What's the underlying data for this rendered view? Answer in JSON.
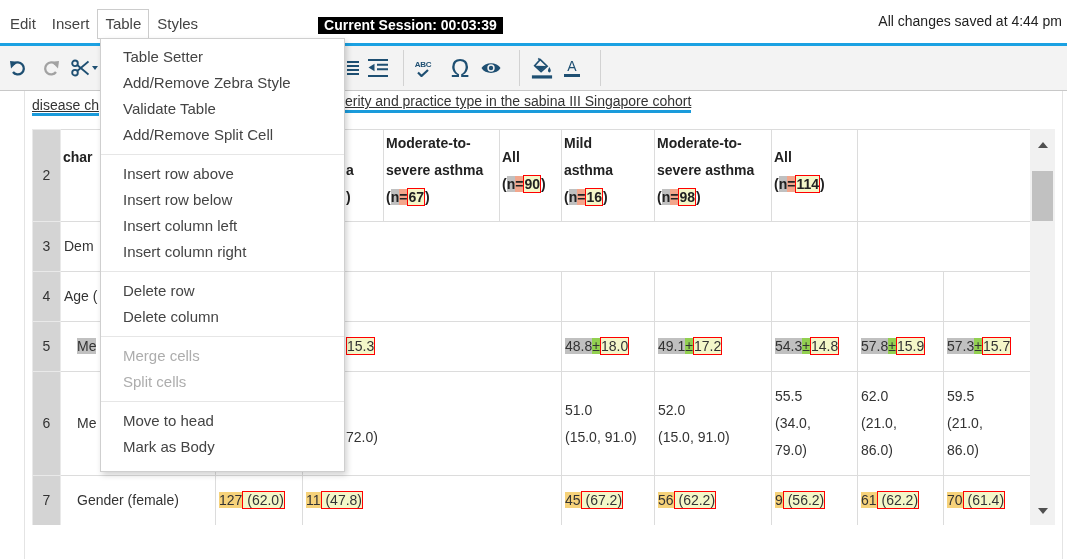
{
  "menubar": {
    "items": [
      {
        "label": "Edit",
        "selected": false
      },
      {
        "label": "Insert",
        "selected": false
      },
      {
        "label": "Table",
        "selected": true
      },
      {
        "label": "Styles",
        "selected": false
      }
    ]
  },
  "session_timer": "Current Session: 00:03:39",
  "save_status": "All changes saved at 4:44 pm",
  "toolbar": {
    "buttons": [
      {
        "disabled": false
      },
      {
        "disabled": true
      },
      {
        "disabled": false
      },
      {
        "disabled": false
      },
      {
        "disabled": false
      },
      {
        "glyph": "ABC",
        "disabled": false
      },
      {
        "glyph": "Ω",
        "disabled": false
      },
      {
        "disabled": false
      },
      {
        "disabled": false
      },
      {
        "glyph": "A",
        "disabled": false
      }
    ]
  },
  "context_menu": {
    "groups": [
      {
        "items": [
          {
            "label": "Table Setter",
            "disabled": false
          },
          {
            "label": "Add/Remove Zebra Style",
            "disabled": false
          },
          {
            "label": "Validate Table",
            "disabled": false
          },
          {
            "label": "Add/Remove Split Cell",
            "disabled": false
          }
        ]
      },
      {
        "items": [
          {
            "label": "Insert row above",
            "disabled": false
          },
          {
            "label": "Insert row below",
            "disabled": false
          },
          {
            "label": "Insert column left",
            "disabled": false
          },
          {
            "label": "Insert column right",
            "disabled": false
          }
        ]
      },
      {
        "items": [
          {
            "label": "Delete row",
            "disabled": false
          },
          {
            "label": "Delete column",
            "disabled": false
          }
        ]
      },
      {
        "items": [
          {
            "label": "Merge cells",
            "disabled": true
          },
          {
            "label": "Split cells",
            "disabled": true
          }
        ]
      },
      {
        "items": [
          {
            "label": "Move to head",
            "disabled": false
          },
          {
            "label": "Mark as Body",
            "disabled": false
          }
        ]
      }
    ]
  },
  "document": {
    "caption": {
      "parts": [
        "disease ch",
        "erity and practice type in the sabina III Singapore cohort"
      ]
    },
    "table": {
      "rows": [
        {
          "number": "2",
          "kind": "header",
          "cells": [
            {
              "lines": [
                "char"
              ]
            },
            "",
            {
              "lines": [
                "a",
                ")"
              ]
            },
            {
              "lines": [
                "Moderate-to-",
                "severe asthma",
                [
                  {
                    "text": "(",
                    "boxed": false
                  },
                  {
                    "text": "n",
                    "color": "#c0c0c0",
                    "boxed": false
                  },
                  {
                    "text": "=",
                    "color": "#f2a68c",
                    "boxed": false
                  },
                  {
                    "text": "67",
                    "color": "#f4f7c9",
                    "boxed": true
                  },
                  {
                    "text": ")",
                    "boxed": false
                  }
                ]
              ]
            },
            {
              "lines": [
                "All",
                [
                  {
                    "text": "(",
                    "boxed": false
                  },
                  {
                    "text": "n",
                    "color": "#c0c0c0",
                    "boxed": false
                  },
                  {
                    "text": "=",
                    "color": "#f2a68c",
                    "boxed": false
                  },
                  {
                    "text": "90",
                    "color": "#f4f7c9",
                    "boxed": true
                  },
                  {
                    "text": ")",
                    "boxed": false
                  }
                ]
              ]
            },
            {
              "lines": [
                "Mild",
                "asthma",
                [
                  {
                    "text": "(",
                    "boxed": false
                  },
                  {
                    "text": "n",
                    "color": "#c0c0c0",
                    "boxed": false
                  },
                  {
                    "text": "=",
                    "color": "#f2a68c",
                    "boxed": false
                  },
                  {
                    "text": "16",
                    "color": "#f4f7c9",
                    "boxed": true
                  },
                  {
                    "text": ")",
                    "boxed": false
                  }
                ]
              ]
            },
            {
              "lines": [
                "Moderate-to-",
                "severe asthma",
                [
                  {
                    "text": "(",
                    "boxed": false
                  },
                  {
                    "text": "n",
                    "color": "#c0c0c0",
                    "boxed": false
                  },
                  {
                    "text": "=",
                    "color": "#f2a68c",
                    "boxed": false
                  },
                  {
                    "text": "98",
                    "color": "#f4f7c9",
                    "boxed": true
                  },
                  {
                    "text": ")",
                    "boxed": false
                  }
                ]
              ]
            },
            {
              "lines": [
                "All",
                [
                  {
                    "text": "(",
                    "boxed": false
                  },
                  {
                    "text": "n",
                    "color": "#c0c0c0",
                    "boxed": false
                  },
                  {
                    "text": "=",
                    "color": "#f2a68c",
                    "boxed": false
                  },
                  {
                    "text": "114",
                    "color": "#f4f7c9",
                    "boxed": true
                  },
                  {
                    "text": ")",
                    "boxed": false
                  }
                ]
              ]
            },
            {
              "colspan": 2
            }
          ]
        },
        {
          "number": "3",
          "kind": "body",
          "cells": [
            {
              "lines": [
                "Dem"
              ],
              "colspan": 8
            },
            {
              "colspan": 2
            }
          ]
        },
        {
          "number": "4",
          "kind": "body",
          "cells": [
            {
              "lines": [
                "Age ("
              ],
              "colspan": 5
            },
            "",
            "",
            "",
            "",
            ""
          ]
        },
        {
          "number": "5",
          "kind": "subrow",
          "cells": [
            {
              "lines": [
                [
                  {
                    "text": "Me",
                    "color": "#c0c0c0",
                    "boxed": false
                  }
                ]
              ]
            },
            "",
            {
              "lines": [
                [
                  {
                    "text": "15.3",
                    "color": "#f4f7c9",
                    "boxed": true
                  }
                ]
              ],
              "colspan": 3
            },
            {
              "lines": [
                [
                  {
                    "text": "48.8",
                    "color": "#c0c0c0",
                    "boxed": false
                  },
                  {
                    "text": "±",
                    "color": "#92d050",
                    "boxed": false
                  },
                  {
                    "text": "18.0",
                    "color": "#f4f7c9",
                    "boxed": true
                  }
                ]
              ]
            },
            {
              "lines": [
                [
                  {
                    "text": "49.1",
                    "color": "#c0c0c0",
                    "boxed": false
                  },
                  {
                    "text": "±",
                    "color": "#92d050",
                    "boxed": false
                  },
                  {
                    "text": "17.2",
                    "color": "#f4f7c9",
                    "boxed": true
                  }
                ]
              ]
            },
            {
              "lines": [
                [
                  {
                    "text": "54.3",
                    "color": "#c0c0c0",
                    "boxed": false
                  },
                  {
                    "text": "±",
                    "color": "#92d050",
                    "boxed": false
                  },
                  {
                    "text": "14.8",
                    "color": "#f4f7c9",
                    "boxed": true
                  }
                ]
              ]
            },
            {
              "lines": [
                [
                  {
                    "text": "57.8",
                    "color": "#c0c0c0",
                    "boxed": false
                  },
                  {
                    "text": "±",
                    "color": "#92d050",
                    "boxed": false
                  },
                  {
                    "text": "15.9",
                    "color": "#f4f7c9",
                    "boxed": true
                  }
                ]
              ]
            },
            {
              "lines": [
                [
                  {
                    "text": "57.3",
                    "color": "#c0c0c0",
                    "boxed": false
                  },
                  {
                    "text": "±",
                    "color": "#92d050",
                    "boxed": false
                  },
                  {
                    "text": "15.7",
                    "color": "#f4f7c9",
                    "boxed": true
                  }
                ]
              ]
            }
          ]
        },
        {
          "number": "6",
          "kind": "subrow",
          "cells": [
            {
              "lines": [
                "Me"
              ]
            },
            "",
            {
              "lines": [
                "72.0)"
              ],
              "colspan": 3
            },
            {
              "lines": [
                "51.0",
                "(15.0, 91.0)"
              ]
            },
            {
              "lines": [
                "52.0",
                "(15.0, 91.0)"
              ]
            },
            {
              "lines": [
                "55.5",
                "(34.0,",
                "79.0)"
              ]
            },
            {
              "lines": [
                "62.0",
                "(21.0,",
                "86.0)"
              ]
            },
            {
              "lines": [
                "59.5",
                "(21.0,",
                "86.0)"
              ]
            }
          ]
        },
        {
          "number": "7",
          "kind": "subrow",
          "cells": [
            {
              "lines": [
                "Gender (female)"
              ]
            },
            {
              "lines": [
                [
                  {
                    "text": "127",
                    "color": "#f6d27a",
                    "boxed": false
                  },
                  {
                    "text": " (62.0)",
                    "color": "#f4f7c9",
                    "boxed": true
                  }
                ]
              ]
            },
            {
              "lines": [
                [
                  {
                    "text": "11",
                    "color": "#f6d27a",
                    "boxed": false
                  },
                  {
                    "text": " (47.8)",
                    "color": "#f4f7c9",
                    "boxed": true
                  }
                ]
              ],
              "colspan": 3
            },
            {
              "lines": [
                [
                  {
                    "text": "45",
                    "color": "#f6d27a",
                    "boxed": false
                  },
                  {
                    "text": " (67.2)",
                    "color": "#f4f7c9",
                    "boxed": true
                  }
                ]
              ]
            },
            {
              "lines": [
                [
                  {
                    "text": "56",
                    "color": "#f6d27a",
                    "boxed": false
                  },
                  {
                    "text": " (62.2)",
                    "color": "#f4f7c9",
                    "boxed": true
                  }
                ]
              ]
            },
            {
              "lines": [
                [
                  {
                    "text": "9",
                    "color": "#f6d27a",
                    "boxed": false
                  },
                  {
                    "text": " (56.2)",
                    "color": "#f4f7c9",
                    "boxed": true
                  }
                ]
              ]
            },
            {
              "lines": [
                [
                  {
                    "text": "61",
                    "color": "#f6d27a",
                    "boxed": false
                  },
                  {
                    "text": " (62.2)",
                    "color": "#f4f7c9",
                    "boxed": true
                  }
                ]
              ]
            },
            {
              "lines": [
                [
                  {
                    "text": "70",
                    "color": "#f6d27a",
                    "boxed": false
                  },
                  {
                    "text": " (61.4)",
                    "color": "#f4f7c9",
                    "boxed": true
                  }
                ]
              ]
            }
          ]
        }
      ]
    }
  }
}
